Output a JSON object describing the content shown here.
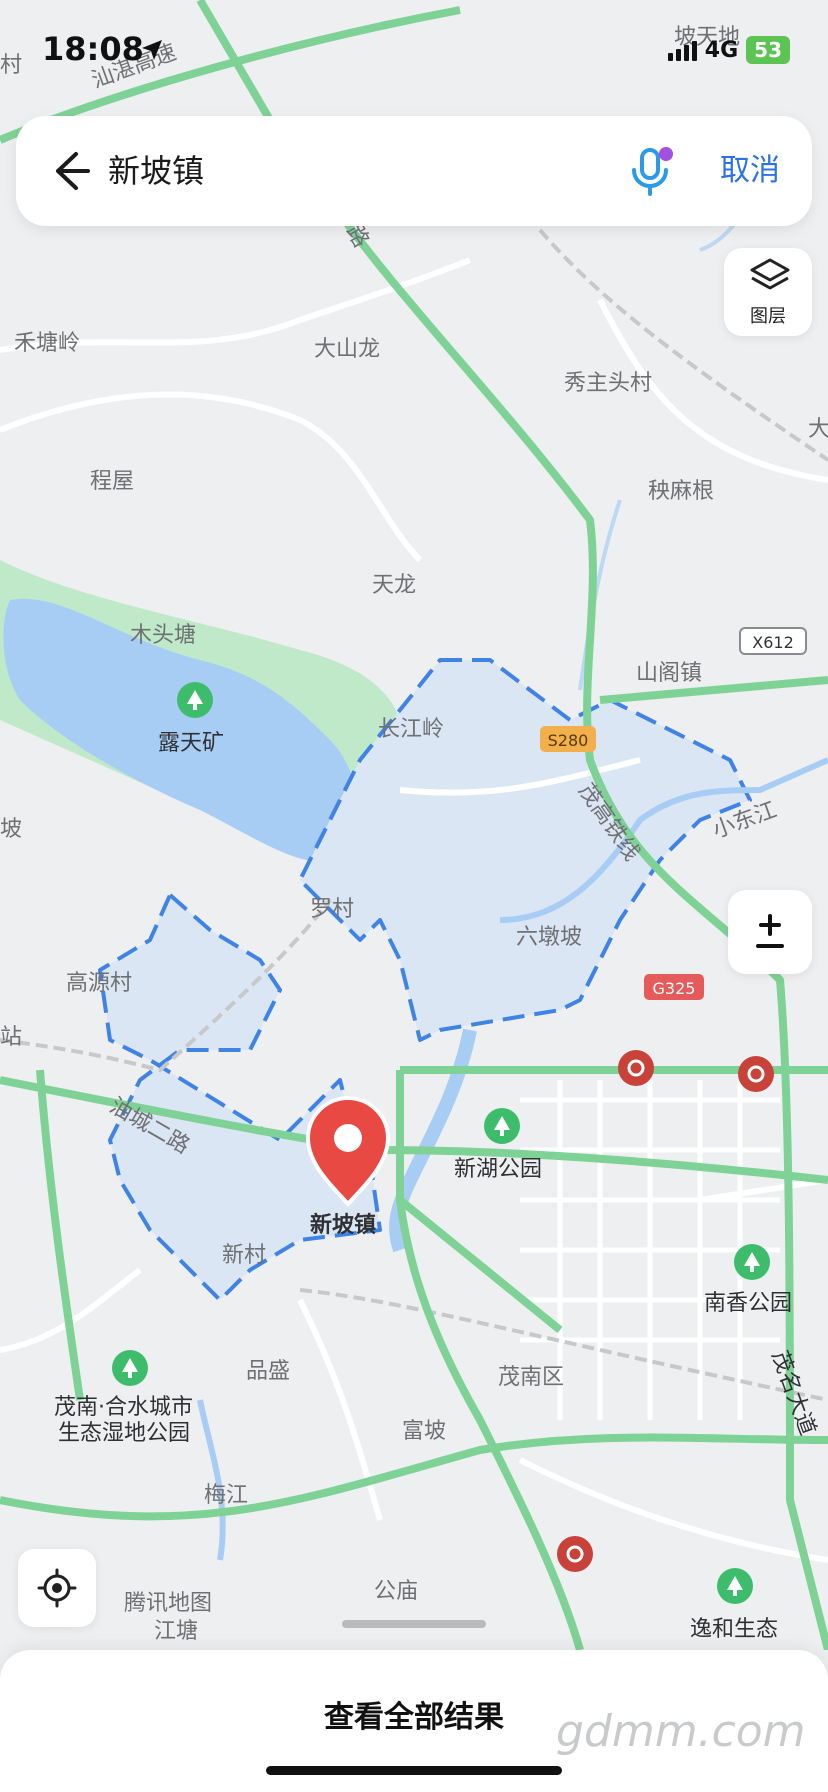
{
  "status_bar": {
    "time": "18:08",
    "network": "4G",
    "battery": "53"
  },
  "search": {
    "query": "新坡镇",
    "cancel_label": "取消"
  },
  "controls": {
    "layer_label": "图层",
    "zoom_symbol": "±"
  },
  "map": {
    "labels": {
      "shantan": "汕湛高速",
      "potian": "坡天地",
      "cun_left": "村",
      "hetangling": "禾塘岭",
      "dashanlong": "大山龙",
      "xiuzhutou": "秀主头村",
      "da": "大",
      "chengwu": "程屋",
      "yangmagen": "秧麻根",
      "tianlong": "天龙",
      "mutoutang": "木头塘",
      "shangezhen": "山阁镇",
      "lutiankuang": "露天矿",
      "changjiangling": "长江岭",
      "po_left": "坡",
      "xiaodongjiang": "小东江",
      "maogao": "茂高铁线",
      "luocun": "罗村",
      "liudunpo": "六墩坡",
      "gaoyuancun": "高源村",
      "zhan": "站",
      "youcheng": "油城二路",
      "xinhupark": "新湖公园",
      "target": "新坡镇",
      "xincun": "新村",
      "nanxiangpark": "南香公园",
      "pinsheng": "品盛",
      "maonan": "茂南区",
      "wetland1": "茂南·合水城市",
      "wetland2": "生态湿地公园",
      "maoming_avenue": "茂名大道",
      "fupo": "富坡",
      "meijiang": "梅江",
      "gongmiao": "公庙",
      "tencent": "腾讯地图",
      "jiangtang": "江塘",
      "yihe": "逸和生态",
      "road_top": "路"
    },
    "shields": {
      "x612": "X612",
      "s280": "S280",
      "g325": "G325"
    }
  },
  "sheet": {
    "title": "查看全部结果",
    "watermark": "gdmm.com"
  },
  "icons": {
    "back": "back-arrow-icon",
    "mic": "microphone-icon",
    "layers": "layers-icon",
    "locate": "locate-icon",
    "park": "park-marker-icon",
    "poi": "poi-red-icon",
    "pin": "location-pin-icon"
  },
  "colors": {
    "accent": "#2b72e8",
    "road": "#7fd296",
    "water": "#a8cdf4",
    "boundary": "#3f83e6",
    "pin": "#e84a43"
  }
}
